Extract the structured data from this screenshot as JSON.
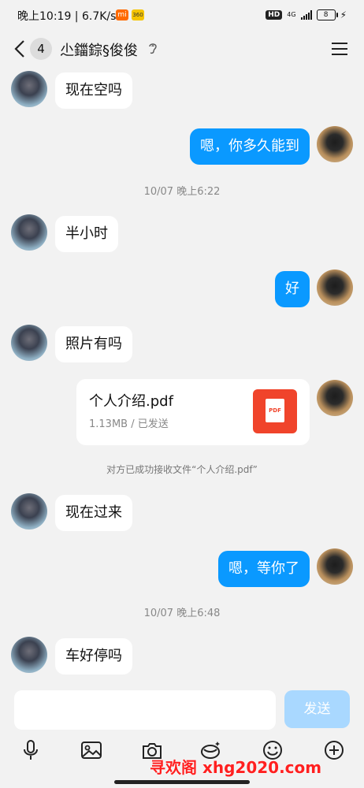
{
  "status_bar": {
    "time": "晚上10:19 | 6.7K/s",
    "badges": [
      "mi",
      "360"
    ],
    "hd": "HD",
    "network": "4G",
    "battery": "8"
  },
  "header": {
    "unread_count": "4",
    "title": "尐鍿錝§俊俊"
  },
  "messages": [
    {
      "side": "in",
      "text": "现在空吗"
    },
    {
      "side": "out",
      "text": "嗯，你多久能到"
    },
    {
      "timestamp": "10/07 晚上6:22"
    },
    {
      "side": "in",
      "text": "半小时"
    },
    {
      "side": "out",
      "text": "好"
    },
    {
      "side": "in",
      "text": "照片有吗"
    },
    {
      "side": "out",
      "file": {
        "name": "个人介绍.pdf",
        "meta": "1.13MB / 已发送",
        "icon_label": "PDF"
      }
    },
    {
      "notice": "对方已成功接收文件“个人介绍.pdf”"
    },
    {
      "side": "in",
      "text": "现在过来"
    },
    {
      "side": "out",
      "text": "嗯，等你了"
    },
    {
      "timestamp": "10/07 晚上6:48"
    },
    {
      "side": "in",
      "text": "车好停吗"
    }
  ],
  "input": {
    "placeholder": "",
    "send_label": "发送"
  },
  "toolbar": {
    "icons": [
      "microphone-icon",
      "image-icon",
      "camera-icon",
      "red-packet-icon",
      "emoji-icon",
      "plus-icon"
    ]
  },
  "watermark": "寻欢阁 xhg2020.com",
  "colors": {
    "outgoing_bubble": "#0a99ff",
    "send_button": "#a9d8ff",
    "pdf_icon": "#f0442b",
    "watermark": "#ff2020"
  }
}
